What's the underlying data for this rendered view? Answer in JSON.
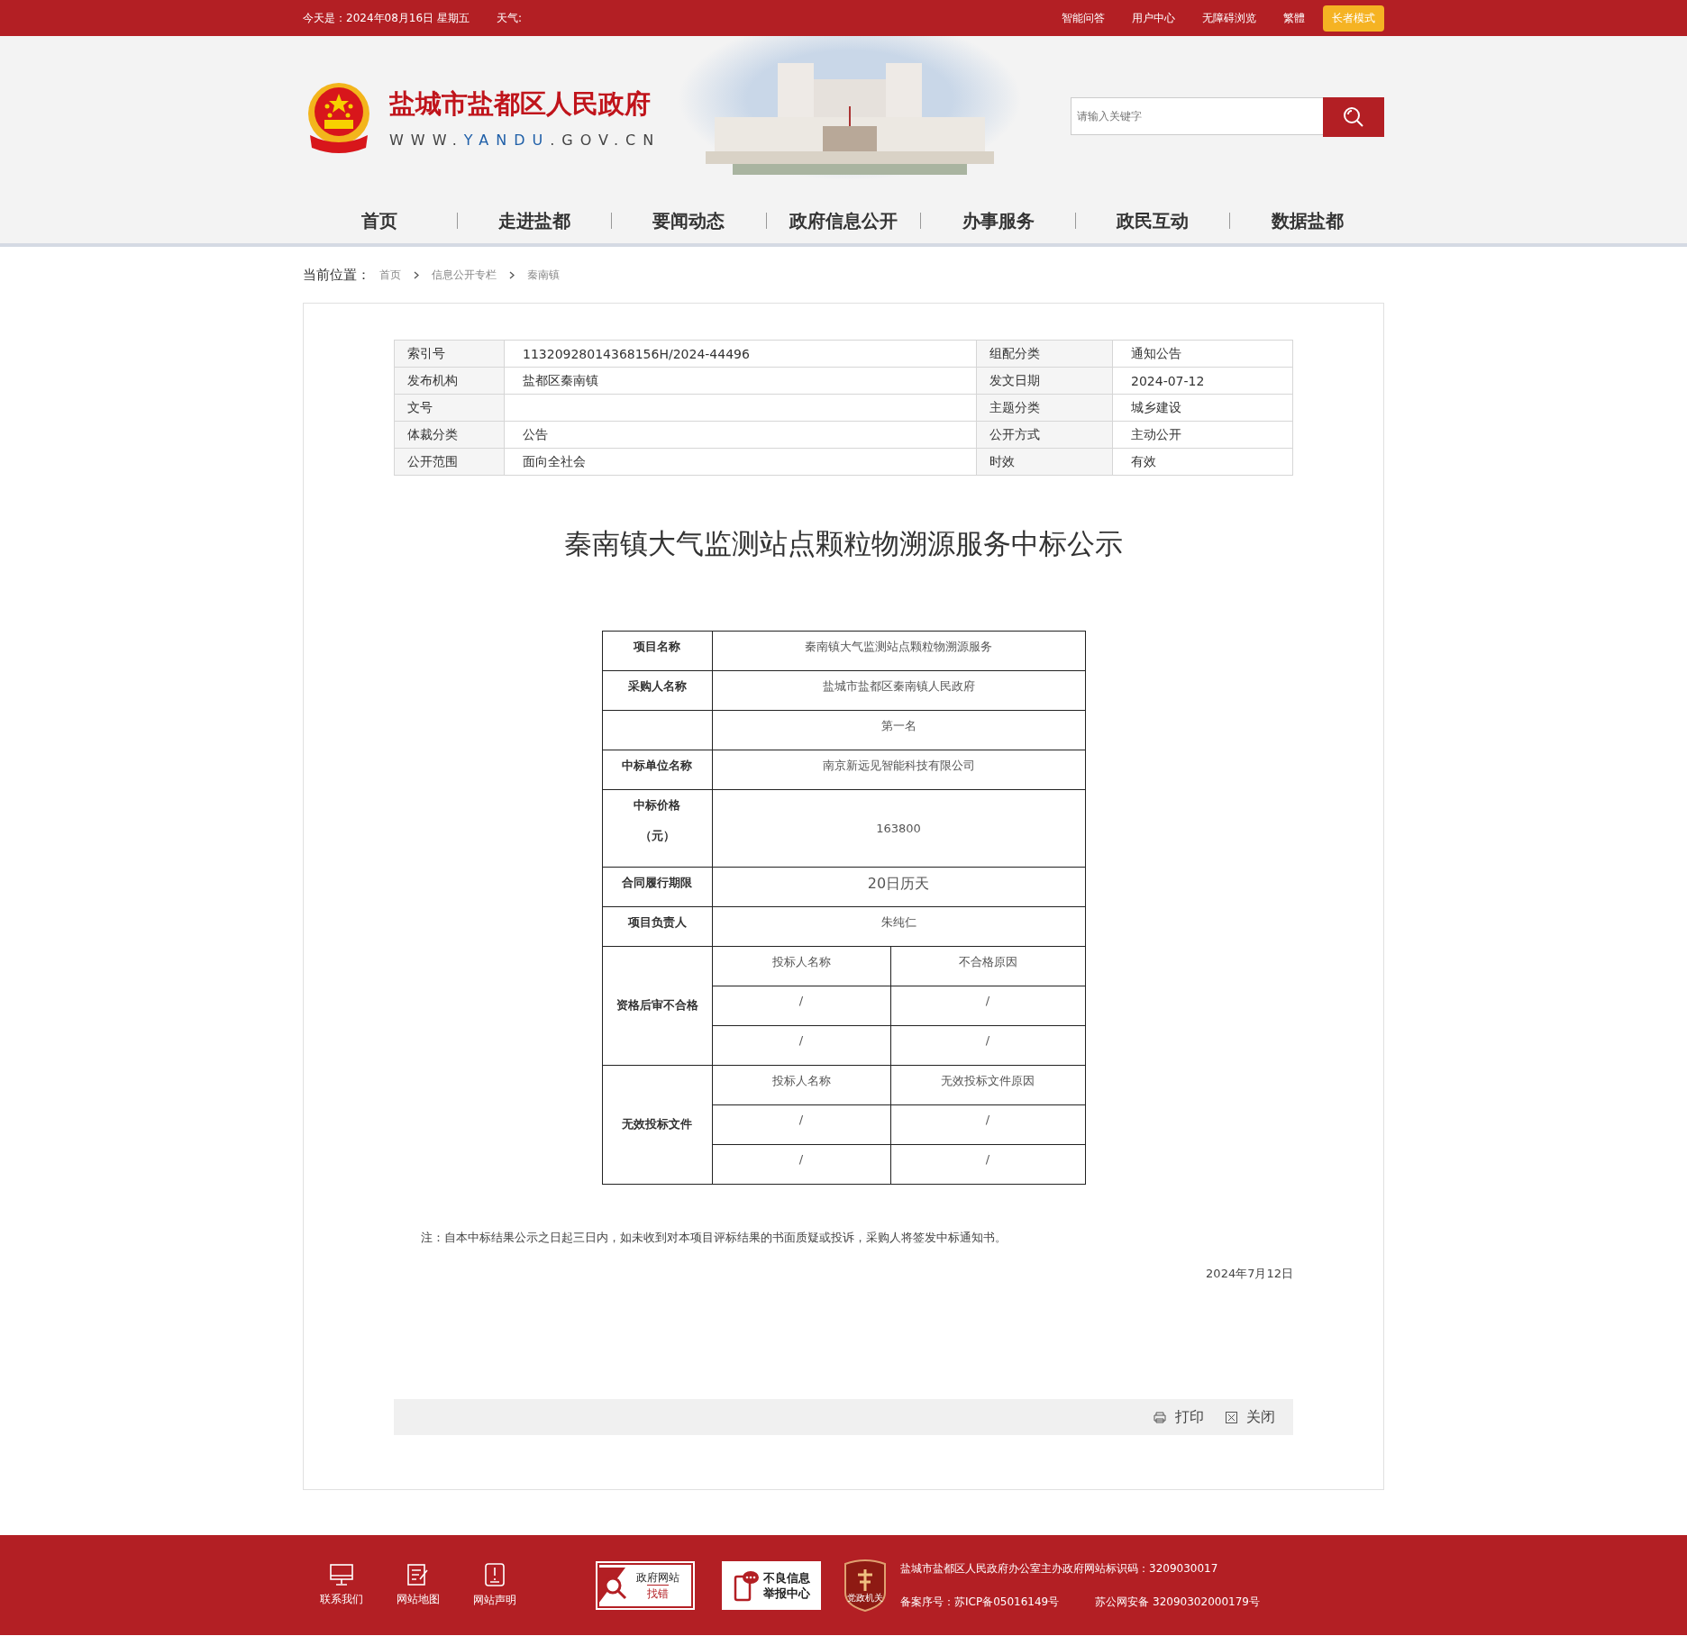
{
  "top_bar": {
    "date_text": "今天是：2024年08月16日 星期五",
    "weather_label": "天气:",
    "links": [
      "智能问答",
      "用户中心",
      "无障碍浏览",
      "繁體"
    ],
    "elder_button": "长者模式"
  },
  "header": {
    "site_title": "盐城市盐都区人民政府",
    "site_url": [
      {
        "text": "WWW.",
        "highlight": false
      },
      {
        "text": "YANDU",
        "highlight": true
      },
      {
        "text": ".GOV.CN",
        "highlight": false
      }
    ],
    "search": {
      "placeholder": "请输入关键字"
    }
  },
  "nav": [
    "首页",
    "走进盐都",
    "要闻动态",
    "政府信息公开",
    "办事服务",
    "政民互动",
    "数据盐都"
  ],
  "breadcrumb": {
    "label": "当前位置：",
    "items": [
      "首页",
      "信息公开专栏",
      "秦南镇"
    ]
  },
  "meta_table": [
    {
      "cells": [
        "索引号",
        "11320928014368156H/2024-44496",
        "组配分类",
        "通知公告"
      ]
    },
    {
      "cells": [
        "发布机构",
        "盐都区秦南镇",
        "发文日期",
        "2024-07-12"
      ]
    },
    {
      "cells": [
        "文号",
        "",
        "主题分类",
        "城乡建设"
      ]
    },
    {
      "cells": [
        "体裁分类",
        "公告",
        "公开方式",
        "主动公开"
      ]
    },
    {
      "cells": [
        "公开范围",
        "面向全社会",
        "时效",
        "有效"
      ]
    }
  ],
  "title": "秦南镇大气监测站点颗粒物溯源服务中标公示",
  "award_table": [
    {
      "kind": "single",
      "label_lines": [
        "项目名称"
      ],
      "value": "秦南镇大气监测站点颗粒物溯源服务",
      "emphasis": false
    },
    {
      "kind": "single",
      "label_lines": [
        "采购人名称"
      ],
      "value": "盐城市盐都区秦南镇人民政府",
      "emphasis": false
    },
    {
      "kind": "single",
      "value": "第一名",
      "emphasis": false
    },
    {
      "kind": "single",
      "label_lines": [
        "中标单位名称"
      ],
      "value": "南京新远见智能科技有限公司",
      "emphasis": false
    },
    {
      "kind": "tall",
      "label_lines": [
        "中标价格",
        "（元）"
      ],
      "value": "163800",
      "emphasis": false
    },
    {
      "kind": "single",
      "label_lines": [
        "合同履行期限"
      ],
      "value": "20日历天",
      "emphasis": true
    },
    {
      "kind": "single",
      "label_lines": [
        "项目负责人"
      ],
      "value": "朱纯仁",
      "emphasis": false
    },
    {
      "kind": "group",
      "label_lines": [
        "资格后审不合格"
      ],
      "columns": [
        "投标人名称",
        "不合格原因"
      ],
      "rows": [
        [
          "/",
          "/"
        ],
        [
          "/",
          "/"
        ]
      ]
    },
    {
      "kind": "group",
      "label_lines": [
        "无效投标文件"
      ],
      "columns": [
        "投标人名称",
        "无效投标文件原因"
      ],
      "rows": [
        [
          "/",
          "/"
        ],
        [
          "/",
          "/"
        ]
      ]
    }
  ],
  "note": "注：自本中标结果公示之日起三日内，如未收到对本项目评标结果的书面质疑或投诉，采购人将签发中标通知书。",
  "date": "2024年7月12日",
  "actions": [
    {
      "kind": "print",
      "label": "打印"
    },
    {
      "kind": "close",
      "label": "关闭"
    }
  ],
  "footer": {
    "links": [
      {
        "kind": "monitor",
        "label": "联系我们"
      },
      {
        "kind": "edit",
        "label": "网站地图"
      },
      {
        "kind": "notice",
        "label": "网站声明"
      }
    ],
    "badges": [
      {
        "kind": "error-report",
        "lines": [
          "政府网站",
          "找错"
        ]
      },
      {
        "kind": "report-center",
        "lines": [
          "不良信息",
          "举报中心"
        ]
      },
      {
        "kind": "party-emblem",
        "lines": [
          "党政机关"
        ]
      }
    ],
    "sponsor": "盐城市盐都区人民政府办公室主办政府网站标识码：3209030017",
    "icp": "备案序号：苏ICP备05016149号",
    "police": "苏公网安备 32090302000179号"
  }
}
